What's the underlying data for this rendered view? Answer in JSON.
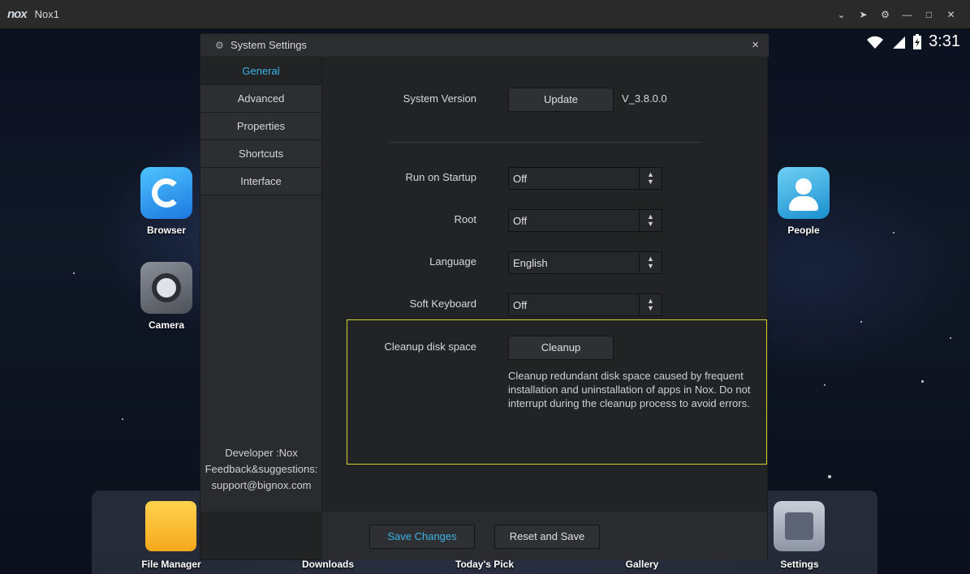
{
  "window": {
    "logo": "nox",
    "title": "Nox1"
  },
  "window_controls": [
    "chevron-down-icon",
    "pin-icon",
    "gear-icon",
    "minimize-icon",
    "maximize-icon",
    "close-icon"
  ],
  "status": {
    "clock": "3:31"
  },
  "desktop_apps": {
    "browser": "Browser",
    "camera": "Camera",
    "people": "People"
  },
  "dock": {
    "file_manager": "File Manager",
    "downloads": "Downloads",
    "todays_pick": "Today's Pick",
    "gallery": "Gallery",
    "settings": "Settings"
  },
  "dialog": {
    "title": "System Settings",
    "close": "×",
    "nav": [
      {
        "label": "General",
        "active": true
      },
      {
        "label": "Advanced"
      },
      {
        "label": "Properties"
      },
      {
        "label": "Shortcuts"
      },
      {
        "label": "Interface"
      }
    ],
    "developer": "Developer :Nox",
    "feedback": "Feedback&suggestions:",
    "email": "support@bignox.com",
    "system_version": {
      "label": "System Version",
      "button": "Update",
      "version": "V_3.8.0.0"
    },
    "run_on_startup": {
      "label": "Run on Startup",
      "value": "Off"
    },
    "root": {
      "label": "Root",
      "value": "Off"
    },
    "language": {
      "label": "Language",
      "value": "English"
    },
    "soft_keyboard": {
      "label": "Soft Keyboard",
      "value": "Off"
    },
    "cleanup": {
      "label": "Cleanup disk space",
      "button": "Cleanup",
      "description": "Cleanup redundant disk space caused by frequent installation and uninstallation of apps in Nox. Do not interrupt during the cleanup process to avoid errors."
    },
    "save_changes": "Save Changes",
    "reset_and_save": "Reset and Save"
  },
  "colors": {
    "accent": "#3bb4e5",
    "highlight_border": "#d6d236"
  }
}
